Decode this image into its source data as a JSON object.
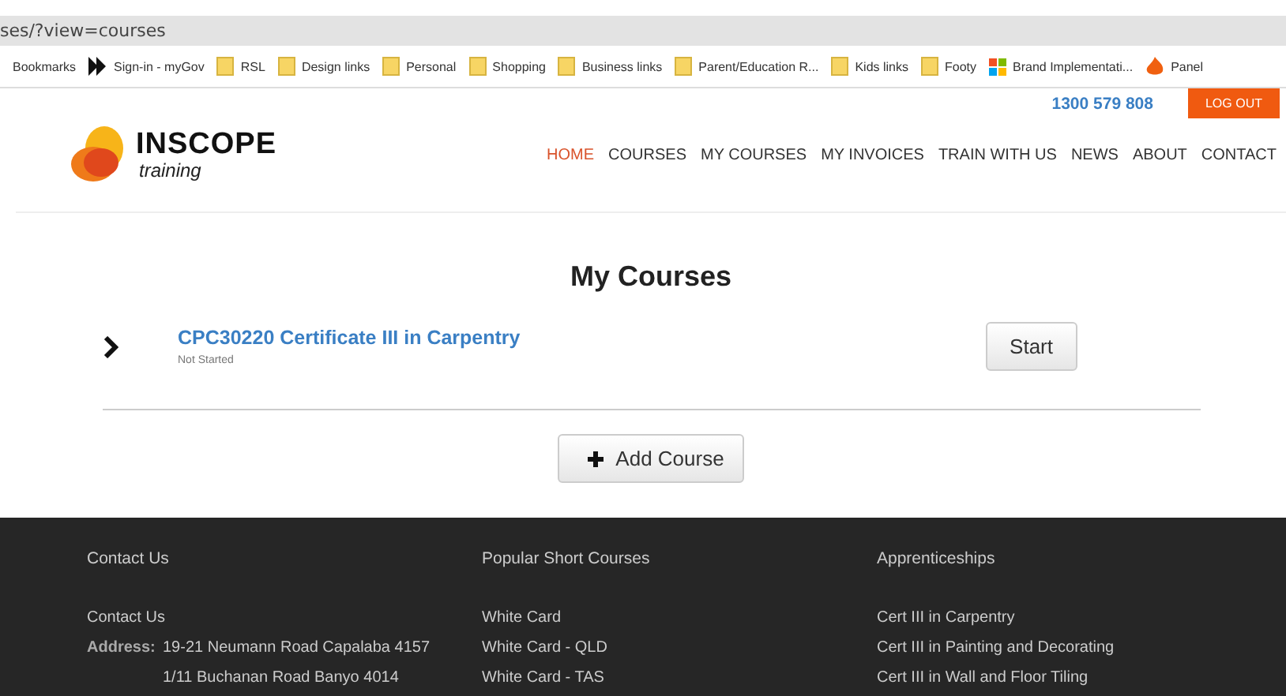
{
  "address_bar": {
    "url": "ses/?view=courses"
  },
  "bookmarks": [
    {
      "label": "Bookmarks",
      "kind": "text"
    },
    {
      "label": "Sign-in - myGov",
      "kind": "logo"
    },
    {
      "label": "RSL",
      "kind": "folder"
    },
    {
      "label": "Design links",
      "kind": "folder"
    },
    {
      "label": "Personal",
      "kind": "folder"
    },
    {
      "label": "Shopping",
      "kind": "folder"
    },
    {
      "label": "Business links",
      "kind": "folder"
    },
    {
      "label": "Parent/Education R...",
      "kind": "folder"
    },
    {
      "label": "Kids links",
      "kind": "folder"
    },
    {
      "label": "Footy",
      "kind": "folder"
    },
    {
      "label": "Brand Implementati...",
      "kind": "grid"
    },
    {
      "label": "Panel",
      "kind": "flame"
    }
  ],
  "header": {
    "phone": "1300 579 808",
    "logout": "LOG OUT",
    "logo_name": "INSCOPE",
    "logo_sub": "training",
    "nav": [
      {
        "label": "HOME",
        "selected": true
      },
      {
        "label": "COURSES",
        "selected": false
      },
      {
        "label": "MY COURSES",
        "selected": false
      },
      {
        "label": "MY INVOICES",
        "selected": false
      },
      {
        "label": "TRAIN WITH US",
        "selected": false
      },
      {
        "label": "NEWS",
        "selected": false
      },
      {
        "label": "ABOUT",
        "selected": false
      },
      {
        "label": "CONTACT",
        "selected": false
      }
    ]
  },
  "main": {
    "title": "My Courses",
    "courses": [
      {
        "name": "CPC30220 Certificate III in Carpentry",
        "status": "Not Started",
        "action": "Start"
      }
    ],
    "add_button": "Add Course"
  },
  "footer": {
    "columns": [
      {
        "heading": "Contact Us",
        "items": [
          {
            "label": "Contact Us"
          },
          {
            "prefix": "Address:",
            "lines": [
              "19-21 Neumann Road Capalaba 4157",
              "1/11 Buchanan Road Banyo 4014"
            ]
          }
        ]
      },
      {
        "heading": "Popular Short Courses",
        "items": [
          {
            "label": "White Card"
          },
          {
            "label": "White Card - QLD"
          },
          {
            "label": "White Card - TAS"
          }
        ]
      },
      {
        "heading": "Apprenticeships",
        "items": [
          {
            "label": "Cert III in Carpentry"
          },
          {
            "label": "Cert III in Painting and Decorating"
          },
          {
            "label": "Cert III in Wall and Floor Tiling"
          }
        ]
      }
    ]
  }
}
